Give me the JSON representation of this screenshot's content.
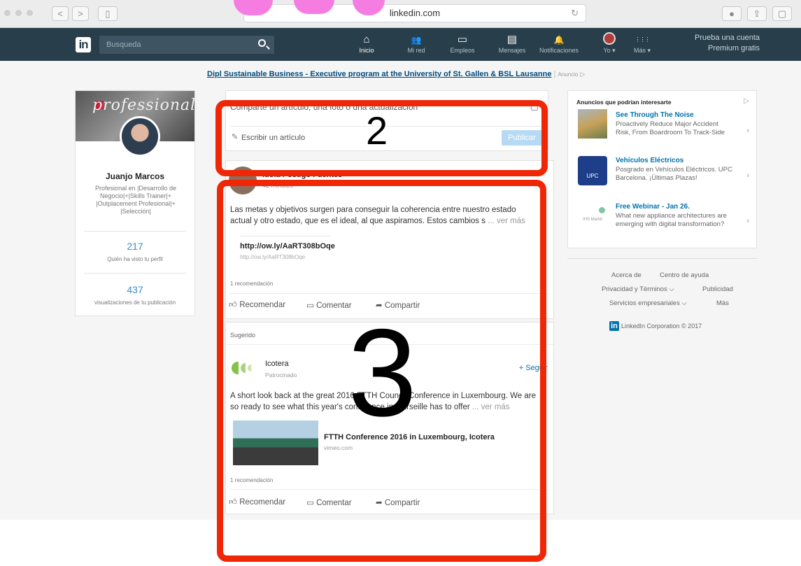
{
  "browser": {
    "url": "linkedin.com",
    "reload_icon": "reload-icon",
    "buttons": {
      "back": "<",
      "forward": ">"
    }
  },
  "nav": {
    "logo": "in",
    "search_placeholder": "Busqueda",
    "items": [
      {
        "label": "Inicio",
        "icon": "home-icon",
        "glyph": "⌂"
      },
      {
        "label": "Mi red",
        "icon": "network-icon",
        "glyph": "👥"
      },
      {
        "label": "Empleos",
        "icon": "briefcase-icon",
        "glyph": "▭"
      },
      {
        "label": "Mensajes",
        "icon": "messages-icon",
        "glyph": "▤"
      },
      {
        "label": "Notificaciones",
        "icon": "bell-icon",
        "glyph": "🔔"
      },
      {
        "label": "Yo ▾",
        "icon": "avatar-icon",
        "glyph": ""
      },
      {
        "label": "Más ▾",
        "icon": "grid-icon",
        "glyph": "⋮⋮⋮"
      }
    ],
    "premium_line1": "Prueba una cuenta",
    "premium_line2": "Premium gratis"
  },
  "top_ad": {
    "link": "Dipl Sustainable Business - Executive program at the University of St. Gallen & BSL Lausanne",
    "tag": "Anuncio"
  },
  "profile": {
    "banner_text": "professional",
    "name": "Juanjo Marcos",
    "headline": "Profesional en |Desarrollo de Negocio|+|Skills Trainer|+ |Outplacement Profesional|+ |Selección|",
    "stat1_value": "217",
    "stat1_label": "Quién ha visto tu perfil",
    "stat2_value": "437",
    "stat2_label": "visualizaciones de tu publicación"
  },
  "share": {
    "placeholder": "Comparte un artículo, una foto o una actualización",
    "write_article": "Escribir un artículo",
    "publish": "Publicar"
  },
  "post1": {
    "author": "Idoia Postigo Fuentes",
    "time": "42 minutos",
    "text": "Las metas y objetivos surgen para conseguir la coherencia entre nuestro estado actual y otro estado, que es el ideal, al que aspiramos. Estos cambios s",
    "more": "... ver más",
    "link_title": "http://ow.ly/AaRT308bOqe",
    "link_url": "http://ow.ly/AaRT308bOqe",
    "recommendations": "1 recomendación",
    "actions": {
      "recommend": "Recomendar",
      "comment": "Comentar",
      "share": "Compartir"
    }
  },
  "post2": {
    "suggested": "Sugerido",
    "company": "Icotera",
    "sponsored": "Patrocinado",
    "follow": "+ Seguir",
    "text": "A short look back at the great 2016 FTTH Council Conference in Luxembourg. We are so ready to see what this year's conference in Marseille has to offer",
    "more": "... ver más",
    "link_title": "FTTH Conference 2016 in Luxembourg, Icotera",
    "link_url": "vimeo.com",
    "recommendations": "1 recomendación",
    "actions": {
      "recommend": "Recomendar",
      "comment": "Comentar",
      "share": "Compartir"
    }
  },
  "right_ads": {
    "title": "Anuncios que podrían interesarte",
    "items": [
      {
        "title": "See Through The Noise",
        "body": "Proactively Reduce Major Accident Risk, From Boardroom To Track-Side"
      },
      {
        "title": "Vehículos Eléctricos",
        "body": "Posgrado en Vehículos Eléctricos. UPC Barcelona. ¡Últimas Plazas!"
      },
      {
        "title": "Free Webinar - Jan 26.",
        "body": "What new appliance architectures are emerging with digital transformation?"
      }
    ],
    "ad2_badge": "UPC",
    "ad3_badge": "IHS Markit"
  },
  "footer": {
    "links": [
      "Acerca de",
      "Centro de ayuda",
      "Privacidad y Términos ⌵",
      "Publicidad",
      "Servicios empresariales ⌵",
      "Más"
    ],
    "copyright": "LinkedIn Corporation © 2017"
  },
  "annotations": {
    "box2_label": "2",
    "box3_label": "3"
  },
  "colors": {
    "nav_bg": "#283e4a",
    "annotation_red": "#f02707",
    "link_blue": "#0073b1"
  }
}
